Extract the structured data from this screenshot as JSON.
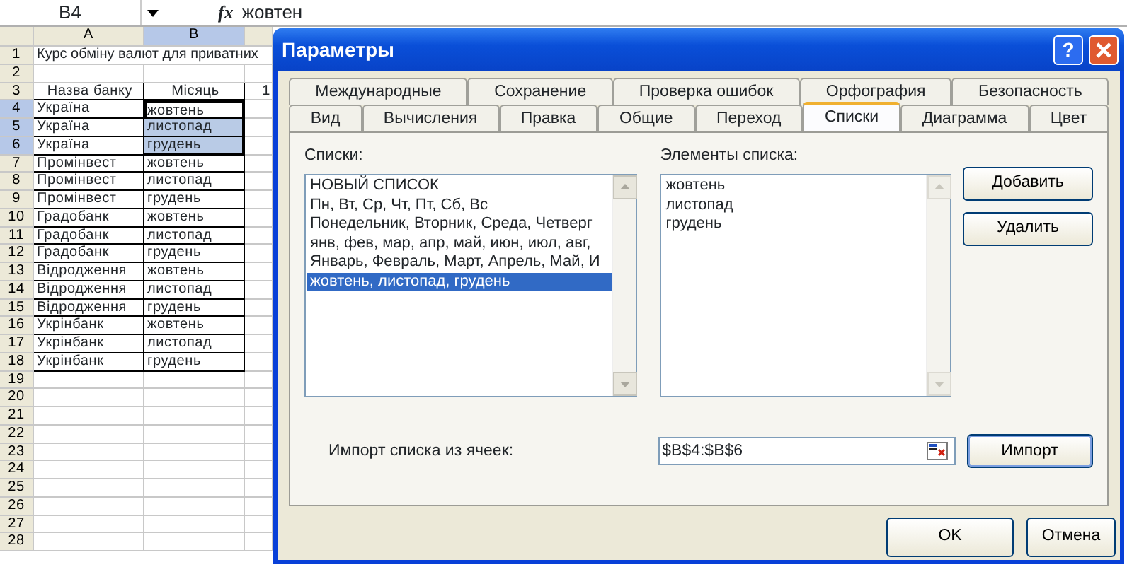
{
  "formula_bar": {
    "name_box": "B4",
    "function_label": "fx",
    "value": "жовтен"
  },
  "sheet": {
    "columns": [
      {
        "label": "A",
        "selected": false
      },
      {
        "label": "B",
        "selected": true
      }
    ],
    "rows": [
      {
        "number": "1",
        "selected": false,
        "cells": [
          "Курс обміну валют для приватних"
        ]
      },
      {
        "number": "2",
        "selected": false,
        "cells": []
      },
      {
        "number": "3",
        "selected": false,
        "cells": [
          "Назва банку",
          "Місяць",
          "1"
        ]
      },
      {
        "number": "4",
        "selected": true,
        "cells": [
          "Україна",
          "жовтень"
        ]
      },
      {
        "number": "5",
        "selected": true,
        "cells": [
          "Україна",
          "листопад"
        ]
      },
      {
        "number": "6",
        "selected": true,
        "cells": [
          "Україна",
          "грудень"
        ]
      },
      {
        "number": "7",
        "selected": false,
        "cells": [
          "Промінвест",
          "жовтень"
        ]
      },
      {
        "number": "8",
        "selected": false,
        "cells": [
          "Промінвест",
          "листопад"
        ]
      },
      {
        "number": "9",
        "selected": false,
        "cells": [
          "Промінвест",
          "грудень"
        ]
      },
      {
        "number": "10",
        "selected": false,
        "cells": [
          "Градобанк",
          "жовтень"
        ]
      },
      {
        "number": "11",
        "selected": false,
        "cells": [
          "Градобанк",
          "листопад"
        ]
      },
      {
        "number": "12",
        "selected": false,
        "cells": [
          "Градобанк",
          "грудень"
        ]
      },
      {
        "number": "13",
        "selected": false,
        "cells": [
          "Відродження",
          "жовтень"
        ]
      },
      {
        "number": "14",
        "selected": false,
        "cells": [
          "Відродження",
          "листопад"
        ]
      },
      {
        "number": "15",
        "selected": false,
        "cells": [
          "Відродження",
          "грудень"
        ]
      },
      {
        "number": "16",
        "selected": false,
        "cells": [
          "Укрінбанк",
          "жовтень"
        ]
      },
      {
        "number": "17",
        "selected": false,
        "cells": [
          "Укрінбанк",
          "листопад"
        ]
      },
      {
        "number": "18",
        "selected": false,
        "cells": [
          "Укрінбанк",
          "грудень"
        ]
      },
      {
        "number": "19",
        "selected": false,
        "cells": []
      },
      {
        "number": "20",
        "selected": false,
        "cells": []
      },
      {
        "number": "21",
        "selected": false,
        "cells": []
      },
      {
        "number": "22",
        "selected": false,
        "cells": []
      },
      {
        "number": "23",
        "selected": false,
        "cells": []
      },
      {
        "number": "24",
        "selected": false,
        "cells": []
      },
      {
        "number": "25",
        "selected": false,
        "cells": []
      },
      {
        "number": "26",
        "selected": false,
        "cells": []
      },
      {
        "number": "27",
        "selected": false,
        "cells": []
      },
      {
        "number": "28",
        "selected": false,
        "cells": []
      }
    ]
  },
  "dialog": {
    "title": "Параметры",
    "help_glyph": "?",
    "tab_rows": [
      [
        {
          "label": "Международные",
          "selected": false
        },
        {
          "label": "Сохранение",
          "selected": false
        },
        {
          "label": "Проверка ошибок",
          "selected": false
        },
        {
          "label": "Орфография",
          "selected": false
        },
        {
          "label": "Безопасность",
          "selected": false
        }
      ],
      [
        {
          "label": "Вид",
          "selected": false
        },
        {
          "label": "Вычисления",
          "selected": false
        },
        {
          "label": "Правка",
          "selected": false
        },
        {
          "label": "Общие",
          "selected": false
        },
        {
          "label": "Переход",
          "selected": false
        },
        {
          "label": "Списки",
          "selected": true
        },
        {
          "label": "Диаграмма",
          "selected": false
        },
        {
          "label": "Цвет",
          "selected": false
        }
      ]
    ],
    "lists_label": "Списки:",
    "lists": [
      {
        "text": "НОВЫЙ СПИСОК",
        "selected": false
      },
      {
        "text": "Пн, Вт, Ср, Чт, Пт, Сб, Вс",
        "selected": false
      },
      {
        "text": "Понедельник, Вторник, Среда, Четверг",
        "selected": false
      },
      {
        "text": "янв, фев, мар, апр, май, июн, июл, авг,",
        "selected": false
      },
      {
        "text": "Январь, Февраль, Март, Апрель, Май, И",
        "selected": false
      },
      {
        "text": "жовтень, листопад, грудень",
        "selected": true
      }
    ],
    "entries_label": "Элементы списка:",
    "entries": [
      "жовтень",
      "листопад",
      "грудень"
    ],
    "side_buttons": [
      "Добавить",
      "Удалить"
    ],
    "import_label": "Импорт списка из ячеек:",
    "import_value": "$B$4:$B$6",
    "import_button": "Импорт",
    "buttons": [
      "OK",
      "Отмена"
    ]
  }
}
